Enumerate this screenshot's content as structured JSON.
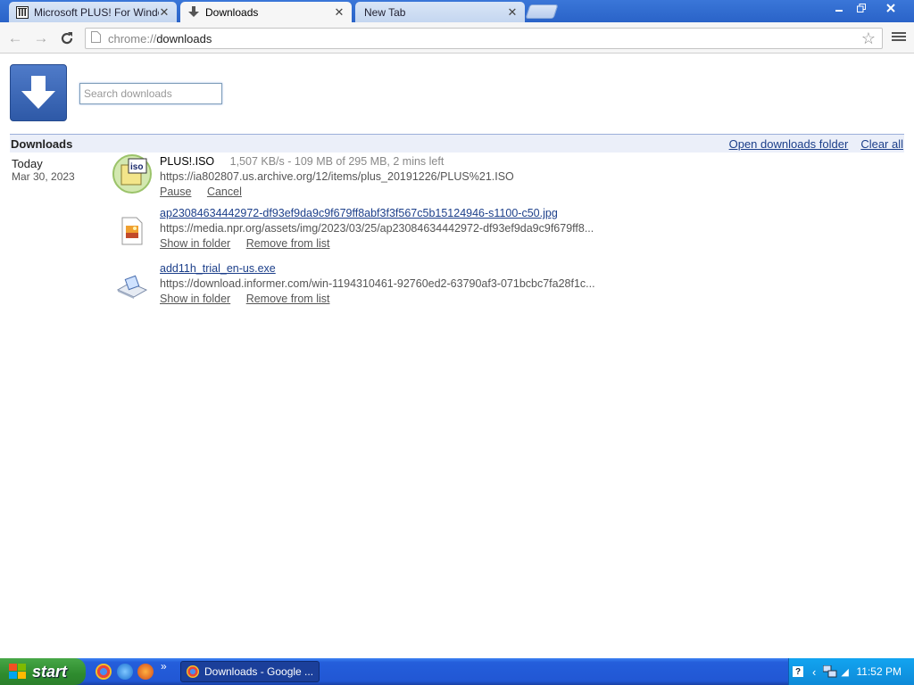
{
  "tabs": [
    {
      "label": "Microsoft PLUS! For Window",
      "icon": "archive-icon"
    },
    {
      "label": "Downloads",
      "icon": "download-icon"
    },
    {
      "label": "New Tab",
      "icon": ""
    }
  ],
  "toolbar": {
    "url_scheme": "chrome://",
    "url_host": "downloads"
  },
  "search": {
    "placeholder": "Search downloads"
  },
  "header": {
    "title": "Downloads",
    "open_folder": "Open downloads folder",
    "clear_all": "Clear all"
  },
  "date": {
    "today": "Today",
    "date": "Mar 30, 2023"
  },
  "downloads": [
    {
      "name": "PLUS!.ISO",
      "status": "1,507 KB/s - 109 MB of 295 MB, 2 mins left",
      "url": "https://ia802807.us.archive.org/12/items/plus_20191226/PLUS%21.ISO",
      "action1": "Pause",
      "action2": "Cancel",
      "icon": "iso-file-icon"
    },
    {
      "name": "ap23084634442972-df93ef9da9c9f679ff8abf3f3f567c5b15124946-s1100-c50.jpg",
      "url": "https://media.npr.org/assets/img/2023/03/25/ap23084634442972-df93ef9da9c9f679ff8...",
      "action1": "Show in folder",
      "action2": "Remove from list",
      "icon": "image-file-icon"
    },
    {
      "name": "add11h_trial_en-us.exe",
      "url": "https://download.informer.com/win-1194310461-92760ed2-63790af3-071bcbc7fa28f1c...",
      "action1": "Show in folder",
      "action2": "Remove from list",
      "icon": "exe-file-icon"
    }
  ],
  "taskbar": {
    "start_label": "start",
    "task_label": "Downloads - Google ...",
    "clock": "11:52 PM"
  }
}
